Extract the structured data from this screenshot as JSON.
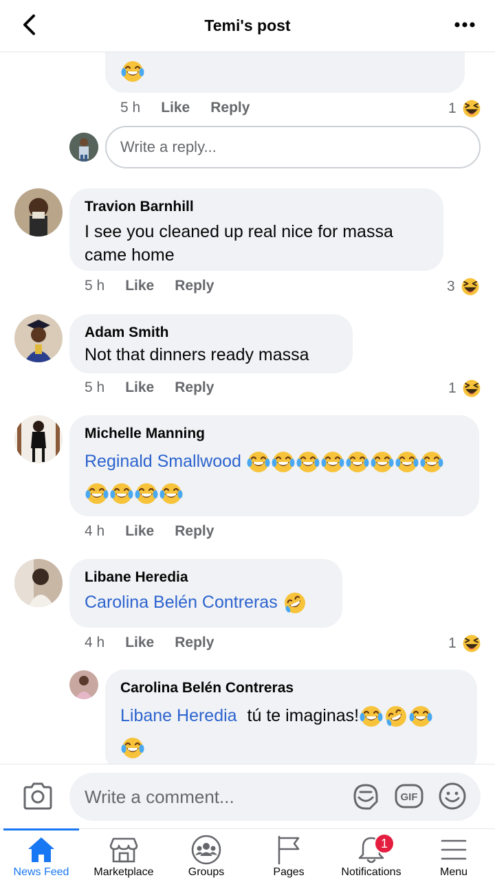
{
  "header": {
    "title": "Temi's post"
  },
  "top_reply": {
    "time": "5 h",
    "like": "Like",
    "reply": "Reply",
    "reaction_count": "1",
    "reply_placeholder": "Write a reply..."
  },
  "comments": [
    {
      "author": "Travion Barnhill",
      "text": "I see you cleaned up real nice for massa came home",
      "time": "5 h",
      "like": "Like",
      "reply": "Reply",
      "reaction_count": "3"
    },
    {
      "author": "Adam Smith",
      "text": "Not that dinners ready massa",
      "time": "5 h",
      "like": "Like",
      "reply": "Reply",
      "reaction_count": "1"
    },
    {
      "author": "Michelle Manning",
      "mention": "Reginald Smallwood",
      "time": "4 h",
      "like": "Like",
      "reply": "Reply"
    },
    {
      "author": "Libane Heredia",
      "mention": "Carolina Belén Contreras",
      "time": "4 h",
      "like": "Like",
      "reply": "Reply",
      "reaction_count": "1"
    }
  ],
  "nested_reply": {
    "author": "Carolina Belén Contreras",
    "mention": "Libane Heredia",
    "text": "tú te imaginas!"
  },
  "composer": {
    "placeholder": "Write a comment..."
  },
  "tabs": [
    {
      "label": "News Feed",
      "icon": "home-icon"
    },
    {
      "label": "Marketplace",
      "icon": "marketplace-icon"
    },
    {
      "label": "Groups",
      "icon": "groups-icon"
    },
    {
      "label": "Pages",
      "icon": "flag-icon"
    },
    {
      "label": "Notifications",
      "icon": "bell-icon",
      "badge": "1"
    },
    {
      "label": "Menu",
      "icon": "hamburger-icon"
    }
  ],
  "colors": {
    "accent": "#1877f2",
    "mention": "#2c63cf",
    "badge": "#e41e3f",
    "bubble": "#f0f2f5"
  }
}
